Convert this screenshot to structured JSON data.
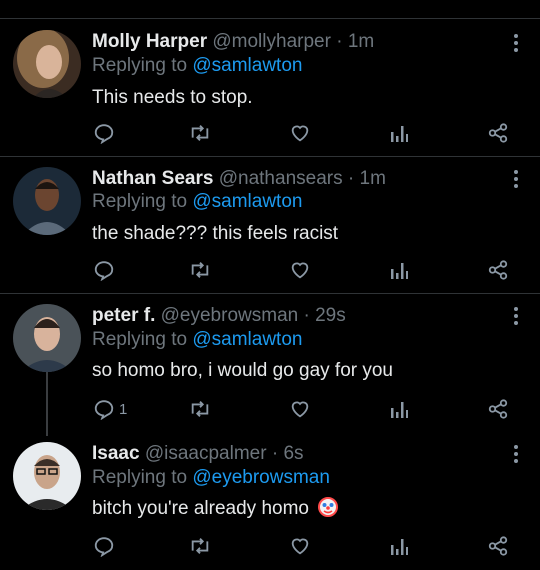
{
  "tweets": [
    {
      "name": "Molly Harper",
      "handle": "@mollyharper",
      "sep": "·",
      "time": "1m",
      "replying_prefix": "Replying to",
      "replying_to": "@samlawton",
      "text": "This needs to stop.",
      "reply_count": ""
    },
    {
      "name": "Nathan Sears",
      "handle": "@nathansears",
      "sep": "·",
      "time": "1m",
      "replying_prefix": "Replying to",
      "replying_to": "@samlawton",
      "text": "the shade??? this feels racist",
      "reply_count": ""
    },
    {
      "name": "peter f.",
      "handle": "@eyebrowsman",
      "sep": "·",
      "time": "29s",
      "replying_prefix": "Replying to",
      "replying_to": "@samlawton",
      "text": "so homo bro, i would go gay for you",
      "reply_count": "1"
    },
    {
      "name": "Isaac",
      "handle": "@isaacpalmer",
      "sep": "·",
      "time": "6s",
      "replying_prefix": "Replying to",
      "replying_to": "@eyebrowsman",
      "text": "bitch you're already homo",
      "reply_count": ""
    }
  ],
  "icons": {
    "reply": "reply-icon",
    "retweet": "retweet-icon",
    "like": "heart-icon",
    "analytics": "analytics-icon",
    "share": "share-icon",
    "more": "more-options-icon",
    "emoji": "clown-emoji"
  },
  "colors": {
    "background": "#000000",
    "text": "#e7e9ea",
    "muted": "#6e767d",
    "link": "#1d9bf0",
    "divider": "#2f3336"
  }
}
